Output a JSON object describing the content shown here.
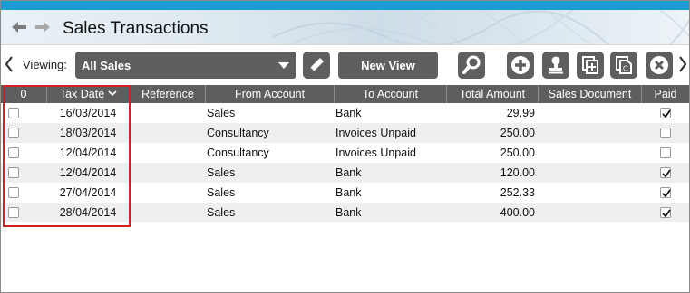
{
  "window": {
    "title": "Sales Transactions"
  },
  "toolbar": {
    "viewing_label": "Viewing:",
    "view_selected": "All Sales",
    "new_view_label": "New View",
    "icons": [
      "edit-pencil-icon",
      "search-icon",
      "add-icon",
      "stamp-icon",
      "copy-add-icon",
      "copy-c-icon",
      "close-icon"
    ]
  },
  "grid": {
    "columns": [
      "0",
      "Tax Date",
      "Reference",
      "From Account",
      "To Account",
      "Total Amount",
      "Sales Document",
      "Paid"
    ],
    "rows": [
      {
        "tax_date": "16/03/2014",
        "reference": "",
        "from_account": "Sales",
        "to_account": "Bank",
        "total_amount": "29.99",
        "sales_document": "",
        "paid": true
      },
      {
        "tax_date": "18/03/2014",
        "reference": "",
        "from_account": "Consultancy",
        "to_account": "Invoices Unpaid",
        "total_amount": "250.00",
        "sales_document": "",
        "paid": false
      },
      {
        "tax_date": "12/04/2014",
        "reference": "",
        "from_account": "Consultancy",
        "to_account": "Invoices Unpaid",
        "total_amount": "250.00",
        "sales_document": "",
        "paid": false
      },
      {
        "tax_date": "12/04/2014",
        "reference": "",
        "from_account": "Sales",
        "to_account": "Bank",
        "total_amount": "120.00",
        "sales_document": "",
        "paid": true
      },
      {
        "tax_date": "27/04/2014",
        "reference": "",
        "from_account": "Sales",
        "to_account": "Bank",
        "total_amount": "252.33",
        "sales_document": "",
        "paid": true
      },
      {
        "tax_date": "28/04/2014",
        "reference": "",
        "from_account": "Sales",
        "to_account": "Bank",
        "total_amount": "400.00",
        "sales_document": "",
        "paid": true
      }
    ]
  },
  "colors": {
    "accent_bar": "#1b9bd4",
    "button_dark": "#5f5f5f",
    "header_bg": "#5e5e5e",
    "highlight": "#d42020"
  }
}
